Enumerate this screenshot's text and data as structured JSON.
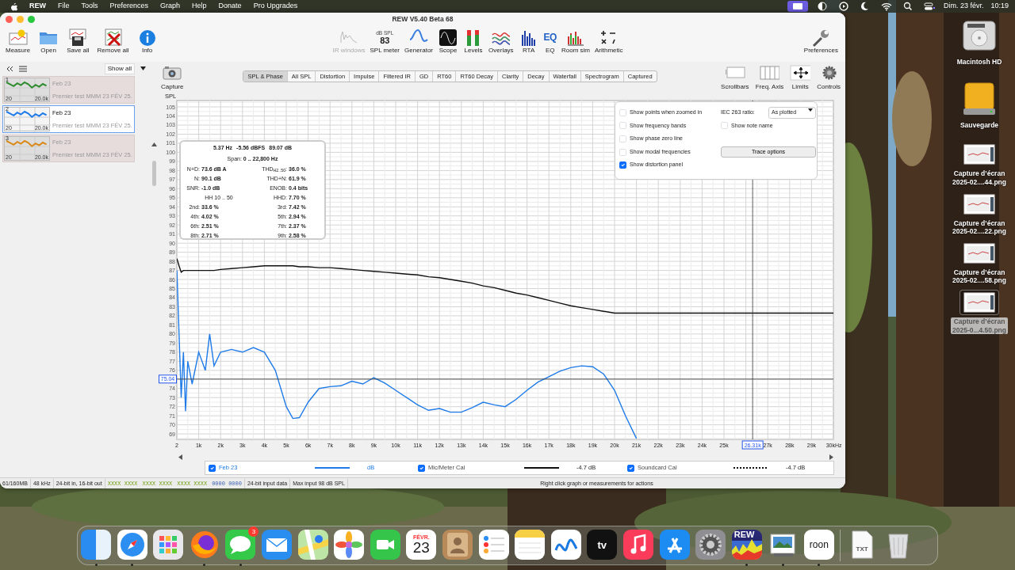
{
  "menubar": {
    "items": [
      {
        "label": "REW",
        "kind": "app"
      },
      {
        "label": "File",
        "kind": "menu"
      },
      {
        "label": "Tools",
        "kind": "menu"
      },
      {
        "label": "Preferences",
        "kind": "menu"
      },
      {
        "label": "Graph",
        "kind": "menu"
      },
      {
        "label": "Help",
        "kind": "menu"
      },
      {
        "label": "Donate",
        "kind": "menu"
      },
      {
        "label": "Pro Upgrades",
        "kind": "menu"
      }
    ],
    "status_icons": [
      {
        "kind": "display",
        "selected": true
      },
      {
        "kind": "half",
        "selected": false
      },
      {
        "kind": "play",
        "selected": false
      },
      {
        "kind": "moon",
        "selected": false
      },
      {
        "kind": "wifi",
        "selected": false
      },
      {
        "kind": "search",
        "selected": false
      },
      {
        "kind": "control",
        "selected": false
      }
    ],
    "date": "Dim. 23 févr.",
    "time": "10:19"
  },
  "window": {
    "title": "REW V5.40 Beta 68"
  },
  "toolbar_left": [
    {
      "label": "Measure",
      "kind": "measure"
    },
    {
      "label": "Open",
      "kind": "open"
    },
    {
      "label": "Save all",
      "kind": "save"
    },
    {
      "label": "Remove all",
      "kind": "remove"
    },
    {
      "label": "Info",
      "kind": "info"
    }
  ],
  "toolbar_tools": [
    {
      "label": "IR windows",
      "kind": "irwin",
      "disabled": true
    },
    {
      "label": "SPL meter",
      "kind": "spl",
      "disabled": false,
      "meter_unit": "dB SPL",
      "meter_value": "83"
    },
    {
      "label": "Generator",
      "kind": "generator",
      "disabled": false
    },
    {
      "label": "Scope",
      "kind": "scope",
      "disabled": false
    },
    {
      "label": "Levels",
      "kind": "levels",
      "disabled": false
    },
    {
      "label": "Overlays",
      "kind": "overlays",
      "disabled": false
    },
    {
      "label": "RTA",
      "kind": "rta",
      "disabled": false
    },
    {
      "label": "EQ",
      "kind": "eq",
      "disabled": false,
      "icon_text": "EQ"
    },
    {
      "label": "Room sim",
      "kind": "roomsim",
      "disabled": false
    },
    {
      "label": "Arithmetic",
      "kind": "arith",
      "disabled": false
    }
  ],
  "preferences": "Preferences",
  "measurements": {
    "filter": "Show all",
    "items": [
      {
        "number": "1",
        "title": "Feb 23",
        "note": "Premier test MMM 23 FÉV 25.",
        "x_start": "20",
        "x_end": "20.0k",
        "color": "#2e8b2e",
        "selected": false
      },
      {
        "number": "2",
        "title": "Feb 23",
        "note": "Premier test MMM 23 FÉV 25.",
        "x_start": "20",
        "x_end": "20.0k",
        "color": "#1e7be8",
        "selected": true
      },
      {
        "number": "3",
        "title": "Feb 23",
        "note": "Premier test MMM 23 FÉV 25.",
        "x_start": "20",
        "x_end": "20.0k",
        "color": "#d98a1a",
        "selected": false
      }
    ]
  },
  "capture": "Capture",
  "graph_tabs": [
    {
      "label": "SPL & Phase",
      "selected": true
    },
    {
      "label": "All SPL",
      "selected": false
    },
    {
      "label": "Distortion",
      "selected": false
    },
    {
      "label": "Impulse",
      "selected": false
    },
    {
      "label": "Filtered IR",
      "selected": false
    },
    {
      "label": "GD",
      "selected": false
    },
    {
      "label": "RT60",
      "selected": false
    },
    {
      "label": "RT60 Decay",
      "selected": false
    },
    {
      "label": "Clarity",
      "selected": false
    },
    {
      "label": "Decay",
      "selected": false
    },
    {
      "label": "Waterfall",
      "selected": false
    },
    {
      "label": "Spectrogram",
      "selected": false
    },
    {
      "label": "Captured",
      "selected": false
    }
  ],
  "graph_controls": [
    {
      "label": "Scrollbars",
      "kind": "scrollbars"
    },
    {
      "label": "Freq. Axis",
      "kind": "freq"
    },
    {
      "label": "Limits",
      "kind": "limits"
    },
    {
      "label": "Controls",
      "kind": "controls"
    }
  ],
  "graph": {
    "chart_data": {
      "type": "line",
      "ylabel": "SPL",
      "x": [
        2,
        100,
        200,
        300,
        400,
        500,
        700,
        1000,
        1300,
        1500,
        1700,
        2000,
        2500,
        3000,
        3500,
        4000,
        4500,
        5000,
        5300,
        5600,
        6000,
        6500,
        7000,
        7500,
        8000,
        8500,
        9000,
        9500,
        10000,
        10500,
        11000,
        11500,
        12000,
        12500,
        13000,
        13500,
        14000,
        14500,
        15000,
        15500,
        16000,
        16500,
        17000,
        17500,
        18000,
        18500,
        19000,
        19500,
        20000,
        20500,
        21000,
        22000,
        25000,
        30000
      ],
      "series": [
        {
          "name": "Feb 23",
          "color": "#1e7be8",
          "values": [
            87,
            80,
            73,
            78,
            71.5,
            77,
            74.5,
            78,
            76,
            80,
            76.5,
            78,
            78.3,
            78,
            78.5,
            78,
            76,
            72,
            70.7,
            70.8,
            72.5,
            74,
            74.2,
            74.3,
            74.8,
            74.5,
            75.2,
            74.6,
            73.8,
            73,
            72.2,
            71.6,
            71.8,
            71.4,
            71.4,
            71.9,
            72.5,
            72.2,
            72,
            72.8,
            73.8,
            74.7,
            75.3,
            75.9,
            76.3,
            76.5,
            76.4,
            75.6,
            73.8,
            71,
            68.5,
            null,
            null,
            null
          ]
        },
        {
          "name": "Mic/Meter Cal",
          "color": "#111111",
          "values": [
            88.3,
            87.5,
            86.8,
            87,
            87,
            87,
            87,
            87,
            87,
            87,
            87,
            87.1,
            87.2,
            87.3,
            87.4,
            87.5,
            87.5,
            87.5,
            87.5,
            87.4,
            87.4,
            87.3,
            87.3,
            87.2,
            87.1,
            87,
            86.9,
            86.8,
            86.7,
            86.6,
            86.5,
            86.3,
            86.2,
            86,
            85.8,
            85.6,
            85.3,
            85.1,
            84.8,
            84.5,
            84.3,
            84,
            83.7,
            83.4,
            83.1,
            82.9,
            82.7,
            82.5,
            82.3,
            82.3,
            82.3,
            82.3,
            82.3,
            82.3
          ]
        }
      ],
      "xlim": [
        0,
        30000
      ],
      "ylim": [
        68.4,
        105.7
      ],
      "grid": true,
      "xlabel": "Hz",
      "xticks": [
        {
          "value": 2,
          "label": "2"
        },
        {
          "value": 1000,
          "label": "1k"
        },
        {
          "value": 2000,
          "label": "2k"
        },
        {
          "value": 3000,
          "label": "3k"
        },
        {
          "value": 4000,
          "label": "4k"
        },
        {
          "value": 5000,
          "label": "5k"
        },
        {
          "value": 6000,
          "label": "6k"
        },
        {
          "value": 7000,
          "label": "7k"
        },
        {
          "value": 8000,
          "label": "8k"
        },
        {
          "value": 9000,
          "label": "9k"
        },
        {
          "value": 10000,
          "label": "10k"
        },
        {
          "value": 11000,
          "label": "11k"
        },
        {
          "value": 12000,
          "label": "12k"
        },
        {
          "value": 13000,
          "label": "13k"
        },
        {
          "value": 14000,
          "label": "14k"
        },
        {
          "value": 15000,
          "label": "15k"
        },
        {
          "value": 16000,
          "label": "16k"
        },
        {
          "value": 17000,
          "label": "17k"
        },
        {
          "value": 18000,
          "label": "18k"
        },
        {
          "value": 19000,
          "label": "19k"
        },
        {
          "value": 20000,
          "label": "20k"
        },
        {
          "value": 21000,
          "label": "21k"
        },
        {
          "value": 22000,
          "label": "22k"
        },
        {
          "value": 23000,
          "label": "23k"
        },
        {
          "value": 24000,
          "label": "24k"
        },
        {
          "value": 25000,
          "label": "25k"
        },
        {
          "value": 27000,
          "label": "27k"
        },
        {
          "value": 28000,
          "label": "28k"
        },
        {
          "value": 29000,
          "label": "29k"
        },
        {
          "value": 30000,
          "label": "30k"
        }
      ],
      "yticks": [
        69,
        70,
        71,
        72,
        73,
        74,
        76,
        77,
        78,
        79,
        80,
        81,
        82,
        83,
        84,
        85,
        86,
        87,
        88,
        89,
        90,
        91,
        92,
        93,
        94,
        95,
        96,
        97,
        98,
        99,
        100,
        101,
        102,
        103,
        104,
        105
      ],
      "ref_lines": [
        {
          "axis": "x",
          "value": 26310,
          "label": "26.31k"
        },
        {
          "axis": "y",
          "value": 75.04,
          "label": "75.04"
        }
      ]
    }
  },
  "distortion_panel": {
    "readout": [
      "5.37 Hz",
      "-5.56 dBFS",
      "89.07 dB"
    ],
    "span": "Span: **0 .. 22,800 Hz**",
    "rows": [
      [
        {
          "label": "N+D:",
          "value": "73.6 dB A"
        },
        {
          "label": "THD$_{H2..50}$:",
          "value": "36.0 %"
        }
      ],
      [
        {
          "label": "N:",
          "value": "90.1 dB"
        },
        {
          "label": "THD+N:",
          "value": "61.9 %"
        }
      ],
      [
        {
          "label": "SNR:",
          "value": "-1.0 dB"
        },
        {
          "label": "ENOB:",
          "value": "0.4 bits"
        }
      ],
      [
        {
          "label": "HH 10 .. 50"
        },
        {
          "label": "HHD:",
          "value": "7.70 %"
        }
      ],
      [
        {
          "label": "2nd:",
          "value": "33.6 %"
        },
        {
          "label": "3rd:",
          "value": "7.42 %"
        }
      ],
      [
        {
          "label": "4th:",
          "value": "4.02 %"
        },
        {
          "label": "5th:",
          "value": "2.94 %"
        }
      ],
      [
        {
          "label": "6th:",
          "value": "2.51 %"
        },
        {
          "label": "7th:",
          "value": "2.37 %"
        }
      ],
      [
        {
          "label": "8th:",
          "value": "2.71 %"
        },
        {
          "label": "9th:",
          "value": "2.58 %"
        }
      ]
    ]
  },
  "graph_options": {
    "checkboxes": [
      {
        "label": "Show points when zoomed in",
        "checked": false
      },
      {
        "label": "Show frequency bands",
        "checked": false
      },
      {
        "label": "Show phase zero line",
        "checked": false
      },
      {
        "label": "Show modal frequencies",
        "checked": false
      },
      {
        "label": "Show distortion panel",
        "checked": true
      }
    ],
    "iec_label": "IEC 263 ratio:",
    "iec_value": "As plotted",
    "note_checkbox": {
      "label": "Show note name",
      "checked": false
    },
    "trace_button": "Trace options"
  },
  "legend": [
    {
      "checked": true,
      "selected": true,
      "kind": "solid",
      "value": "dB"
    },
    {
      "checked": true,
      "selected": false,
      "kind": "solid",
      "value": "-4.7 dB"
    },
    {
      "name": "Soundcard Cal",
      "checked": true,
      "selected": false,
      "color": "#111111",
      "kind": "dotted",
      "value": "-4.7 dB"
    }
  ],
  "status_bar": [
    {
      "text": "61/160MB",
      "kind": "plain"
    },
    {
      "text": "48 kHz",
      "kind": "plain"
    },
    {
      "text": "24-bit in, 16-bit out",
      "kind": "plain"
    },
    {
      "text": "XXXX XXXX",
      "kind": "level_in"
    },
    {
      "text": "XXXX XXXX",
      "kind": "level_in"
    },
    {
      "text": "XXXX XXXX",
      "kind": "level_in"
    },
    {
      "text": "0000 0000",
      "kind": "level_out"
    },
    {
      "text": "24-bit input data",
      "kind": "plain"
    },
    {
      "text": "Max input 98 dB SPL",
      "kind": "plain"
    },
    {
      "text": "Right click graph or measurements for actions",
      "kind": "message"
    }
  ],
  "desktop_icons": [
    {
      "label": "Macintosh HD",
      "kind": "disk",
      "selected": false
    },
    {
      "label": "Sauvegarde",
      "kind": "drive",
      "selected": false
    },
    {
      "label": "Capture d’écran\n2025-02....44.png",
      "kind": "screenshot",
      "selected": false
    },
    {
      "label": "Capture d’écran\n2025-02....22.png",
      "kind": "screenshot",
      "selected": false
    },
    {
      "label": "Capture d’écran\n2025-02....58.png",
      "kind": "screenshot",
      "selected": false
    },
    {
      "label": "Capture d’écran\n2025-0...4.50.png",
      "kind": "screenshot",
      "selected": true
    }
  ],
  "dock": [
    {
      "kind": "finder",
      "running": true
    },
    {
      "kind": "safari",
      "running": true
    },
    {
      "kind": "launchpad",
      "running": false
    },
    {
      "kind": "firefox",
      "running": true
    },
    {
      "kind": "messages",
      "running": true,
      "badge": "3"
    },
    {
      "kind": "mail",
      "running": false
    },
    {
      "kind": "maps",
      "running": false
    },
    {
      "kind": "photos",
      "running": false
    },
    {
      "kind": "facetime",
      "running": false
    },
    {
      "kind": "calendar",
      "running": false,
      "month": "FÉVR.",
      "day": "23"
    },
    {
      "kind": "contacts",
      "running": false
    },
    {
      "kind": "reminders",
      "running": false
    },
    {
      "kind": "notes",
      "running": false
    },
    {
      "kind": "freeform",
      "running": false
    },
    {
      "kind": "tv",
      "running": false,
      "icon_text": "tv"
    },
    {
      "kind": "music",
      "running": false
    },
    {
      "kind": "appstore",
      "running": false
    },
    {
      "kind": "settings",
      "running": false
    },
    {
      "kind": "rew",
      "running": true,
      "icon_text": "REW"
    },
    {
      "kind": "preview",
      "running": true
    },
    {
      "kind": "roon",
      "running": true,
      "icon_text": "roon"
    },
    {
      "kind": "separator"
    },
    {
      "kind": "document",
      "running": false,
      "icon_text": "TXT"
    },
    {
      "kind": "trash",
      "running": false
    }
  ]
}
